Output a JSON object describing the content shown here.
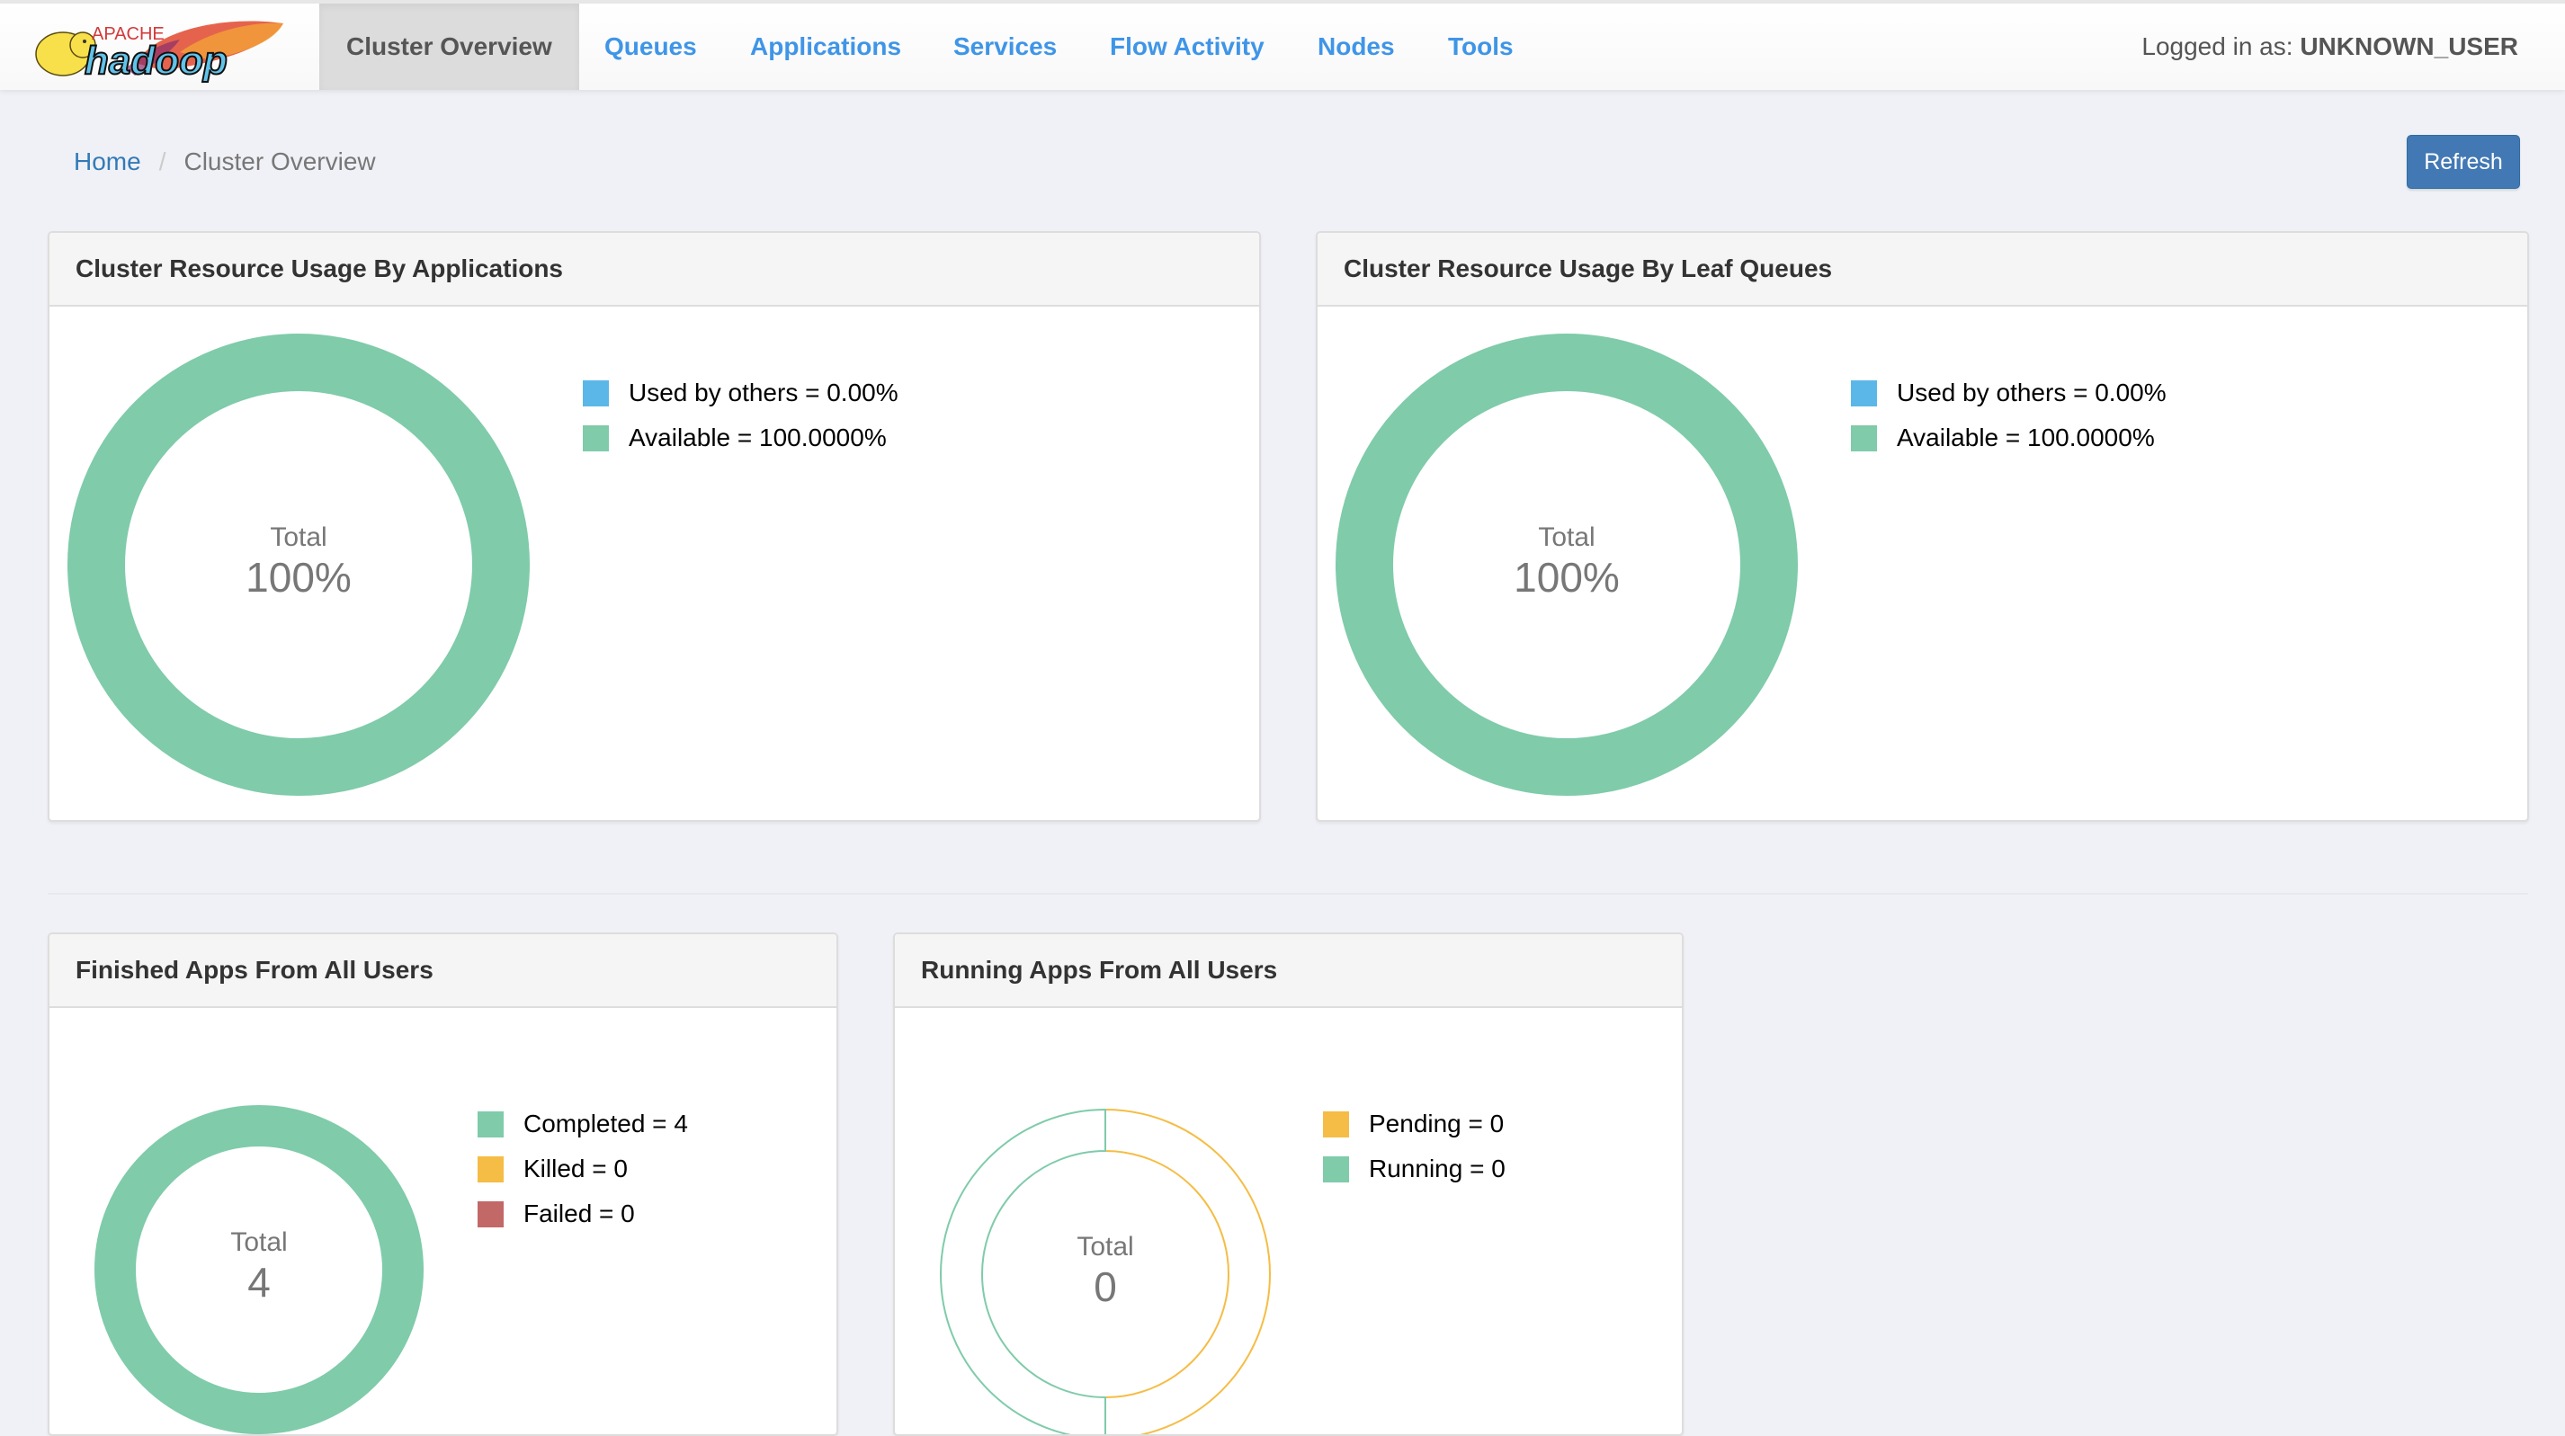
{
  "navbar": {
    "logo": {
      "top_text": "APACHE",
      "main_text": "hadoop"
    },
    "items": [
      {
        "label": "Cluster Overview",
        "active": true
      },
      {
        "label": "Queues",
        "active": false
      },
      {
        "label": "Applications",
        "active": false
      },
      {
        "label": "Services",
        "active": false
      },
      {
        "label": "Flow Activity",
        "active": false
      },
      {
        "label": "Nodes",
        "active": false
      },
      {
        "label": "Tools",
        "active": false
      }
    ],
    "login_prefix": "Logged in as:",
    "login_user": "UNKNOWN_USER"
  },
  "breadcrumb": {
    "home": "Home",
    "separator": "/",
    "current": "Cluster Overview"
  },
  "toolbar": {
    "refresh_label": "Refresh"
  },
  "colors": {
    "green": "#7fcbaa",
    "blue": "#5bb7e8",
    "yellow": "#f5bd45",
    "red": "#c26867",
    "nav_link": "#3f95e7",
    "button": "#4278b3"
  },
  "chart_data": [
    {
      "type": "pie",
      "style": "donut",
      "title": "Cluster Resource Usage By Applications",
      "center_label": "Total",
      "center_value": "100%",
      "slices": [
        {
          "name": "Used by others",
          "value": 0.0,
          "legend": "Used by others = 0.00%",
          "color": "#5bb7e8"
        },
        {
          "name": "Available",
          "value": 100.0,
          "legend": "Available = 100.0000%",
          "color": "#7fcbaa"
        }
      ]
    },
    {
      "type": "pie",
      "style": "donut",
      "title": "Cluster Resource Usage By Leaf Queues",
      "center_label": "Total",
      "center_value": "100%",
      "slices": [
        {
          "name": "Used by others",
          "value": 0.0,
          "legend": "Used by others = 0.00%",
          "color": "#5bb7e8"
        },
        {
          "name": "Available",
          "value": 100.0,
          "legend": "Available = 100.0000%",
          "color": "#7fcbaa"
        }
      ]
    },
    {
      "type": "pie",
      "style": "donut",
      "title": "Finished Apps From All Users",
      "center_label": "Total",
      "center_value": "4",
      "slices": [
        {
          "name": "Completed",
          "value": 4,
          "legend": "Completed = 4",
          "color": "#7fcbaa"
        },
        {
          "name": "Killed",
          "value": 0,
          "legend": "Killed = 0",
          "color": "#f5bd45"
        },
        {
          "name": "Failed",
          "value": 0,
          "legend": "Failed = 0",
          "color": "#c26867"
        }
      ]
    },
    {
      "type": "pie",
      "style": "donut-empty",
      "title": "Running Apps From All Users",
      "center_label": "Total",
      "center_value": "0",
      "slices": [
        {
          "name": "Pending",
          "value": 0,
          "legend": "Pending = 0",
          "color": "#f5bd45"
        },
        {
          "name": "Running",
          "value": 0,
          "legend": "Running = 0",
          "color": "#7fcbaa"
        }
      ]
    }
  ]
}
